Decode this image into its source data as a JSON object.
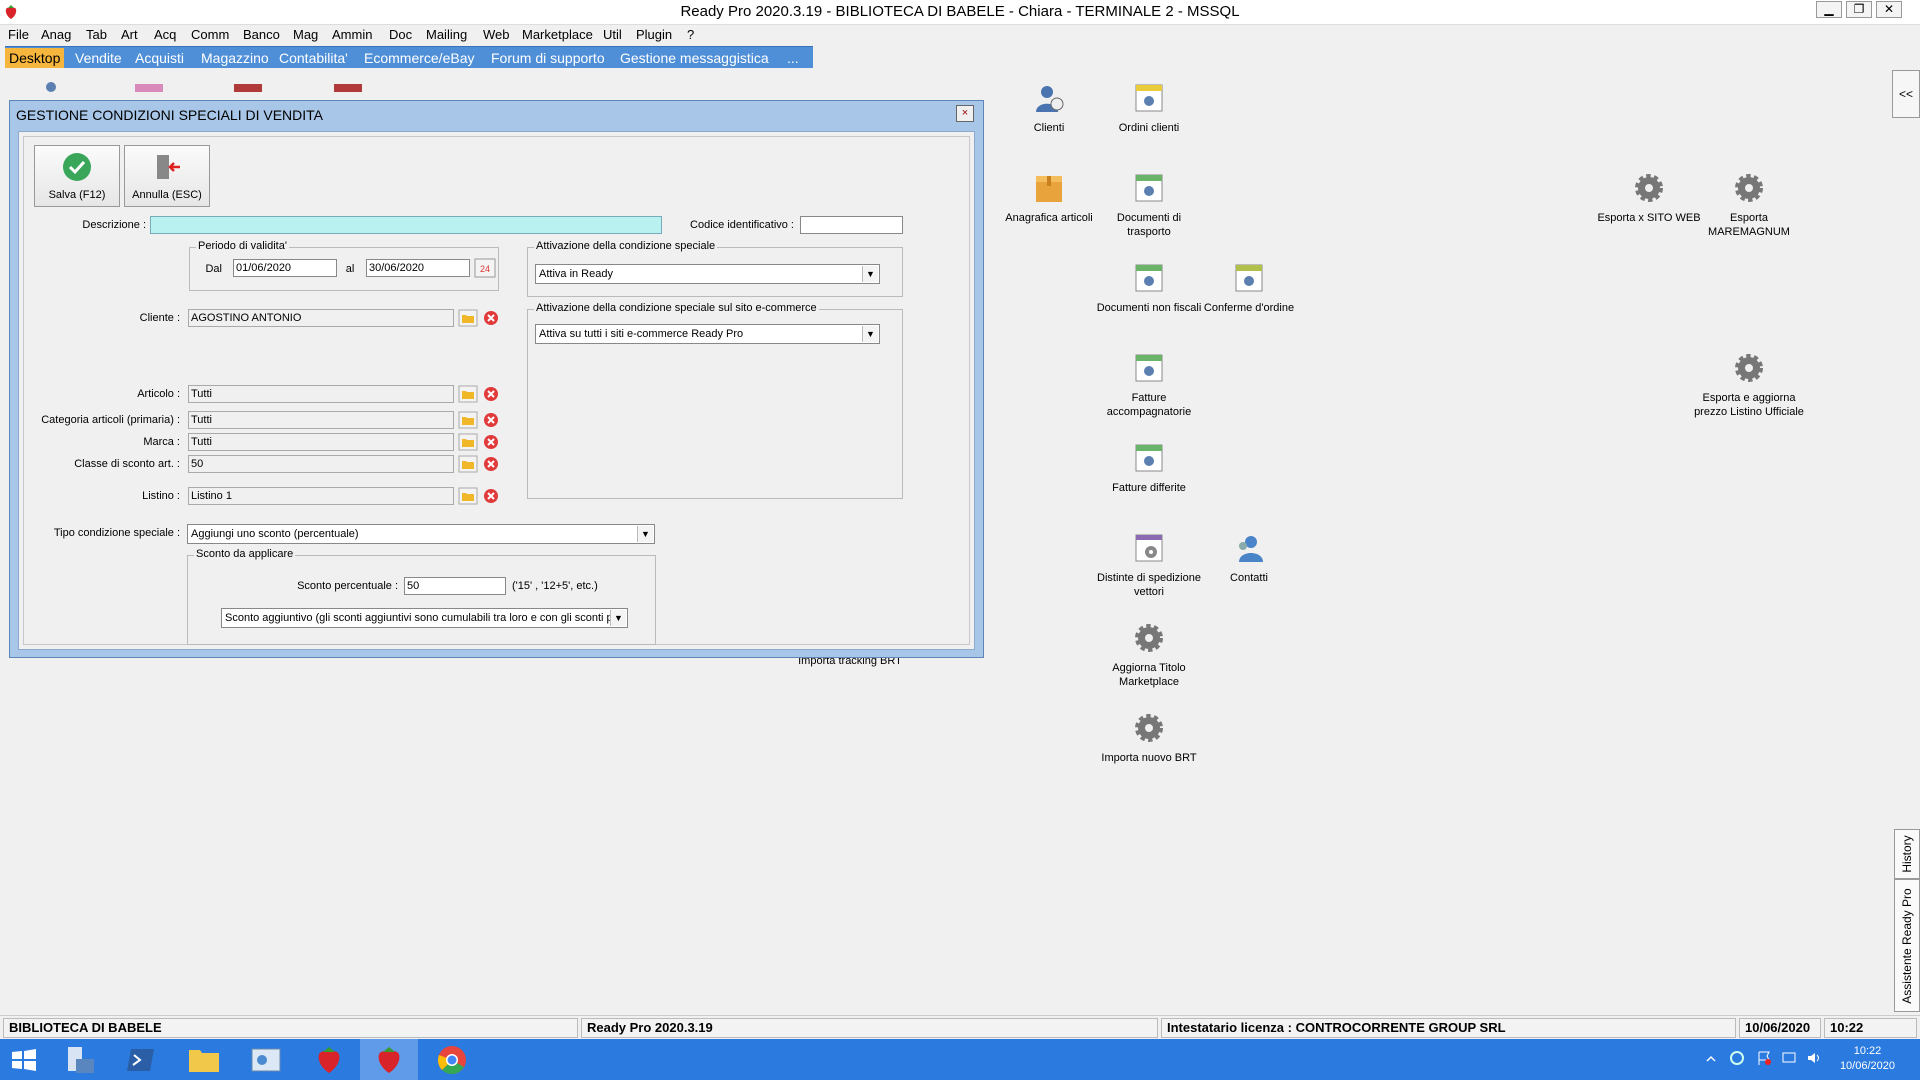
{
  "window": {
    "title": "Ready Pro 2020.3.19 - BIBLIOTECA DI BABELE - Chiara - TERMINALE 2 - MSSQL"
  },
  "menu": [
    "File",
    "Anag",
    "Tab",
    "Art",
    "Acq",
    "Comm",
    "Banco",
    "Mag",
    "Ammin",
    "Doc",
    "Mailing",
    "Web",
    "Marketplace",
    "Util",
    "Plugin",
    "?"
  ],
  "tabs": [
    "Desktop",
    "Vendite",
    "Acquisti",
    "Magazzino",
    "Contabilita'",
    "Ecommerce/eBay",
    "Forum di supporto",
    "Gestione messaggistica",
    "..."
  ],
  "desktop_icons": {
    "clienti": "Clienti",
    "ordini_clienti": "Ordini clienti",
    "anagrafica_articoli": "Anagrafica articoli",
    "documenti_trasporto": "Documenti di trasporto",
    "documenti_non_fiscali": "Documenti non fiscali",
    "conferme_ordine": "Conferme d'ordine",
    "fatture_accompagnatorie": "Fatture accompagnatorie",
    "fatture_differite": "Fatture differite",
    "distinte_spedizione": "Distinte di spedizione vettori",
    "contatti": "Contatti",
    "aggiorna_titolo": "Aggiorna Titolo Marketplace",
    "importa_brt": "Importa nuovo BRT",
    "importa_tracking": "Importa tracking BRT",
    "esporta_sito": "Esporta x SITO WEB",
    "esporta_maremagnum": "Esporta MAREMAGNUM",
    "esporta_listino": "Esporta e aggiorna prezzo Listino Ufficiale"
  },
  "side": {
    "collapse": "<<",
    "history": "History",
    "assistente": "Assistente Ready Pro"
  },
  "dialog": {
    "title": "GESTIONE CONDIZIONI SPECIALI DI VENDITA",
    "close": "×",
    "buttons": {
      "save": "Salva (F12)",
      "cancel": "Annulla (ESC)"
    },
    "descrizione_label": "Descrizione :",
    "descrizione_value": "",
    "codice_label": "Codice identificativo :",
    "codice_value": "",
    "periodo": {
      "title": "Periodo di validita'",
      "dal_label": "Dal",
      "dal_value": "01/06/2020",
      "al_label": "al",
      "al_value": "30/06/2020"
    },
    "cliente_label": "Cliente :",
    "cliente_value": "AGOSTINO ANTONIO",
    "articolo_label": "Articolo :",
    "articolo_value": "Tutti",
    "categoria_label": "Categoria articoli (primaria) :",
    "categoria_value": "Tutti",
    "marca_label": "Marca :",
    "marca_value": "Tutti",
    "classe_label": "Classe di sconto art. :",
    "classe_value": "50",
    "listino_label": "Listino :",
    "listino_value": "Listino 1",
    "attivazione": {
      "title": "Attivazione della condizione speciale",
      "value": "Attiva in Ready"
    },
    "attivazione_web": {
      "title": "Attivazione della condizione speciale sul sito e-commerce",
      "value": "Attiva su tutti i siti e-commerce Ready Pro"
    },
    "tipo_label": "Tipo condizione speciale :",
    "tipo_value": "Aggiungi uno sconto (percentuale)",
    "sconto": {
      "title": "Sconto da applicare",
      "percent_label": "Sconto percentuale :",
      "percent_value": "50",
      "percent_hint": "('15' , '12+5', etc.)",
      "mode_value": "Sconto aggiuntivo (gli sconti aggiuntivi sono cumulabili tra loro e con gli sconti prin"
    }
  },
  "status": {
    "company": "BIBLIOTECA DI BABELE",
    "version": "Ready Pro 2020.3.19",
    "license": "Intestatario licenza : CONTROCORRENTE GROUP SRL",
    "date": "10/06/2020",
    "time": "10:22"
  },
  "taskbar": {
    "clock_time": "10:22",
    "clock_date": "10/06/2020"
  }
}
